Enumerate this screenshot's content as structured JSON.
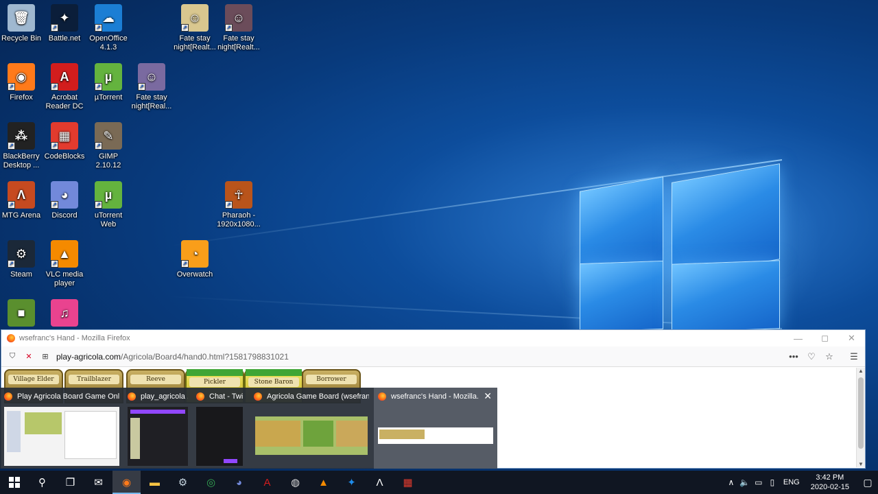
{
  "desktop_icons": [
    {
      "label": "Recycle Bin",
      "icon": "recycle-bin-icon",
      "color": "#9fb8d0"
    },
    {
      "label": "Battle.net",
      "icon": "battlenet-icon",
      "color": "#0b1e3a"
    },
    {
      "label": "OpenOffice 4.1.3",
      "icon": "openoffice-icon",
      "color": "#1b7ed4"
    },
    {
      "label": "Fate stay night[Realt...",
      "icon": "fate-icon",
      "color": "#d9c78f"
    },
    {
      "label": "Fate stay night[Realt...",
      "icon": "fate-ubw-icon",
      "color": "#6b4c5a"
    },
    {
      "label": "Firefox",
      "icon": "firefox-icon",
      "color": "#ff7a1a"
    },
    {
      "label": "Acrobat Reader DC",
      "icon": "acrobat-icon",
      "color": "#d21d1d"
    },
    {
      "label": "µTorrent",
      "icon": "utorrent-icon",
      "color": "#64b33e"
    },
    {
      "label": "Fate stay night[Real...",
      "icon": "fate-hf-icon",
      "color": "#7a6aa0"
    },
    {
      "label": "BlackBerry Desktop ...",
      "icon": "blackberry-icon",
      "color": "#222222"
    },
    {
      "label": "CodeBlocks",
      "icon": "codeblocks-icon",
      "color": "#e23b2e"
    },
    {
      "label": "GIMP 2.10.12",
      "icon": "gimp-icon",
      "color": "#7a6a55"
    },
    {
      "label": "MTG Arena",
      "icon": "mtg-arena-icon",
      "color": "#c64a20"
    },
    {
      "label": "Discord",
      "icon": "discord-icon",
      "color": "#7289da"
    },
    {
      "label": "uTorrent Web",
      "icon": "utorrent-web-icon",
      "color": "#64b33e"
    },
    {
      "label": "Pharaoh - 1920x1080...",
      "icon": "pharaoh-icon",
      "color": "#b9541b"
    },
    {
      "label": "Steam",
      "icon": "steam-icon",
      "color": "#1b2838"
    },
    {
      "label": "VLC media player",
      "icon": "vlc-icon",
      "color": "#f58a00"
    },
    {
      "label": "Overwatch",
      "icon": "overwatch-icon",
      "color": "#f99e1a"
    },
    {
      "label": "",
      "icon": "minecraft-icon",
      "color": "#5a8f2e"
    },
    {
      "label": "",
      "icon": "itunes-icon",
      "color": "#e9438f"
    }
  ],
  "firefox": {
    "title": "wsefranc's Hand - Mozilla Firefox",
    "url_domain": "play-agricola.com",
    "url_path": "/Agricola/Board4/hand0.html?1581798831021",
    "cards": [
      {
        "name": "Village Elder",
        "style": "gold"
      },
      {
        "name": "Trailblazer",
        "style": "gold"
      },
      {
        "name": "Reeve",
        "style": "gold"
      },
      {
        "name": "Pickler",
        "style": "green"
      },
      {
        "name": "Stone Baron",
        "style": "green"
      },
      {
        "name": "Borrower",
        "style": "gold"
      }
    ]
  },
  "thumbnails": [
    {
      "title": "Play Agricola Board Game Onli...",
      "active": false,
      "preview_color": "#f3f3f3"
    },
    {
      "title": "play_agricola ...",
      "active": false,
      "preview_color": "#1f1f24"
    },
    {
      "title": "Chat - Twi...",
      "active": false,
      "preview_color": "#18181b"
    },
    {
      "title": "Agricola Game Board (wsefranc...",
      "active": false,
      "preview_color": "#a9c06a"
    },
    {
      "title": "wsefranc's Hand - Mozilla...",
      "active": true,
      "preview_color": "#ffffff"
    }
  ],
  "taskbar": {
    "apps": [
      {
        "name": "mail",
        "icon": "mail-icon",
        "color": "#ffffff"
      },
      {
        "name": "firefox",
        "icon": "firefox-icon",
        "color": "#ff7a1a",
        "active": true
      },
      {
        "name": "explorer",
        "icon": "folder-icon",
        "color": "#f6c343"
      },
      {
        "name": "steam",
        "icon": "steam-icon",
        "color": "#c7d5e0"
      },
      {
        "name": "chrome",
        "icon": "chrome-icon",
        "color": "#34a853"
      },
      {
        "name": "discord",
        "icon": "discord-icon",
        "color": "#7289da"
      },
      {
        "name": "acrobat",
        "icon": "acrobat-icon",
        "color": "#d21d1d"
      },
      {
        "name": "obs",
        "icon": "obs-icon",
        "color": "#dddddd"
      },
      {
        "name": "vlc",
        "icon": "vlc-icon",
        "color": "#f58a00"
      },
      {
        "name": "battlenet",
        "icon": "battlenet-icon",
        "color": "#1f8ceb"
      },
      {
        "name": "mtg-arena",
        "icon": "mtg-arena-icon",
        "color": "#ffffff"
      },
      {
        "name": "codeblocks",
        "icon": "codeblocks-icon",
        "color": "#e23b2e"
      }
    ],
    "language": "ENG",
    "time": "3:42 PM",
    "date": "2020-02-15"
  }
}
